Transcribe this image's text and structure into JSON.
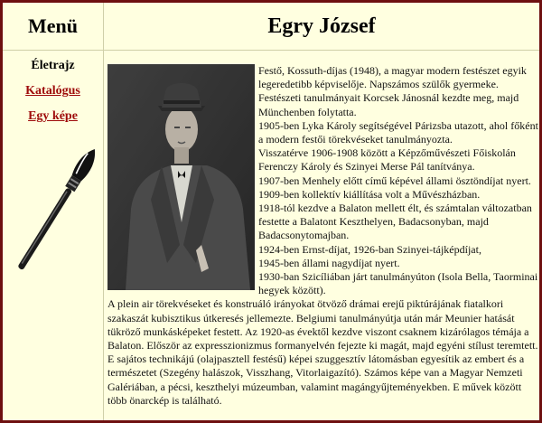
{
  "menu": {
    "title": "Menü",
    "items": [
      {
        "label": "Életrajz",
        "active": true
      },
      {
        "label": "Katalógus",
        "active": false
      },
      {
        "label": "Egy képe",
        "active": false
      }
    ]
  },
  "page": {
    "title": "Egry József"
  },
  "bio": {
    "intro": "Festő, Kossuth-díjas (1948), a magyar modern festészet egyik legeredetibb képviselője. Napszámos szülők gyermeke. Festészeti tanulmányait Korcsek Jánosnál kezdte meg, majd Münchenben folytatta.",
    "entries": [
      "1905-ben Lyka Károly segítségével Párizsba utazott, ahol főként a modern festői törekvéseket tanulmányozta.",
      "Visszatérve 1906-1908 között a Képzőművészeti Főiskolán Ferenczy Károly és Szinyei Merse Pál tanítványa.",
      "1907-ben Menhely előtt című képével állami ösztöndíjat nyert.",
      "1909-ben kollektív kiállítása volt a Művészházban.",
      "1918-tól kezdve a Balaton mellett élt, és számtalan változatban festette a Balatont Keszthelyen, Badacsonyban, majd Badacsonytomajban.",
      "1924-ben Ernst-díjat, 1926-ban Szinyei-tájképdíjat,",
      "1945-ben állami nagydíjat nyert.",
      "1930-ban Szicíliában járt tanulmányúton (Isola Bella, Taorminai hegyek között)."
    ],
    "closing": "A plein air törekvéseket és konstruáló irányokat ötvöző drámai erejű piktúrájának fiatalkori szakaszát kubisztikus útkeresés jellemezte. Belgiumi tanulmányútja után már Meunier hatását tükröző munkásképeket festett. Az 1920-as évektől kezdve viszont csaknem kizárólagos témája a Balaton. Először az expresszionizmus formanyelvén fejezte ki magát, majd egyéni stílust teremtett. E sajátos technikájú (olajpasztell festésű) képei szuggesztív látomásban egyesítik az embert és a természetet (Szegény halászok, Visszhang, Vitorlaigazító). Számos képe van a Magyar Nemzeti Galériában, a pécsi, keszthelyi múzeumban, valamint magángyűjteményekben. E művek között több önarckép is található."
  },
  "icons": {
    "brush": "paintbrush-icon",
    "portrait": "portrait-photo"
  },
  "colors": {
    "border": "#6e1010",
    "background": "#ffffe0",
    "link": "#9e0b0b"
  }
}
